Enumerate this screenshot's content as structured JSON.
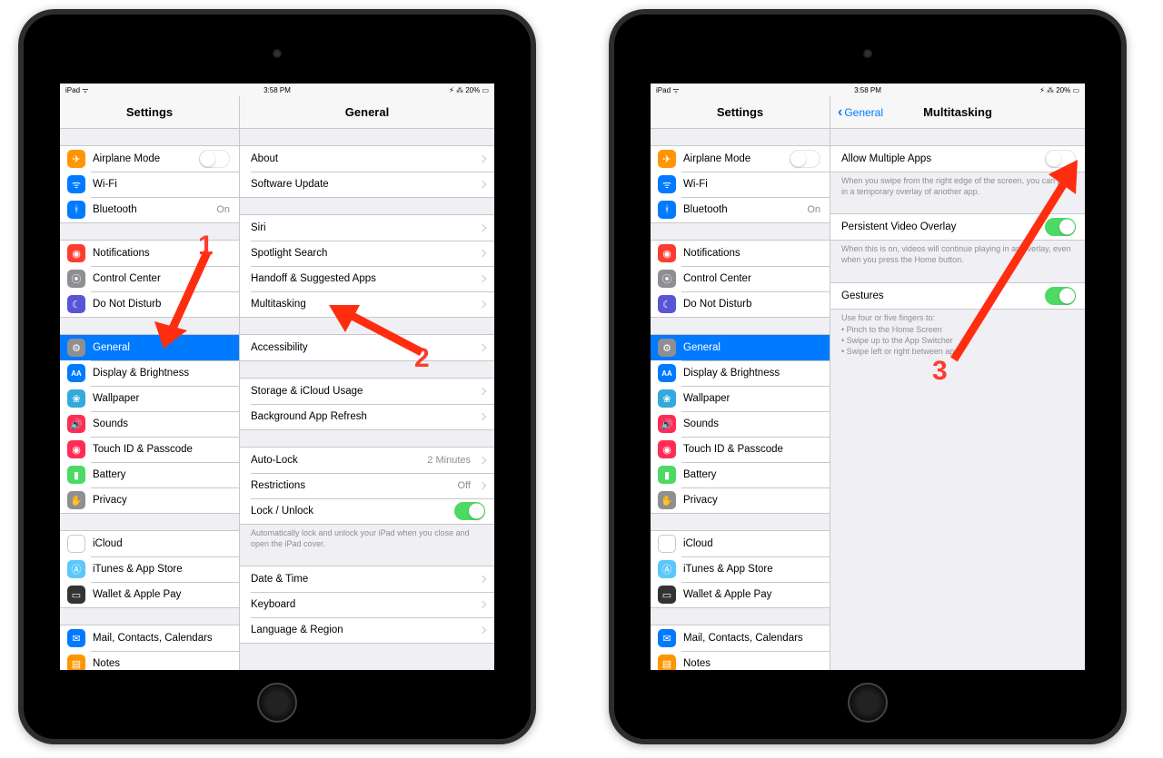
{
  "status": {
    "carrier": "iPad ᯤ",
    "time": "3:58 PM",
    "battery": "⚡︎ ⁂ 20% ▭"
  },
  "sidebar": {
    "title": "Settings",
    "groups": [
      [
        {
          "icon": "airplane-icon",
          "color": "i-orange",
          "glyph": "✈",
          "label": "Airplane Mode",
          "toggle": false
        },
        {
          "icon": "wifi-icon",
          "color": "i-blue",
          "glyph": "ᯤ",
          "label": "Wi-Fi"
        },
        {
          "icon": "bluetooth-icon",
          "color": "i-blue",
          "glyph": "ᚼ",
          "label": "Bluetooth",
          "value": "On"
        }
      ],
      [
        {
          "icon": "notifications-icon",
          "color": "i-red",
          "glyph": "◉",
          "label": "Notifications"
        },
        {
          "icon": "control-center-icon",
          "color": "i-gray",
          "glyph": "⦿",
          "label": "Control Center"
        },
        {
          "icon": "dnd-icon",
          "color": "i-purple",
          "glyph": "☾",
          "label": "Do Not Disturb"
        }
      ],
      [
        {
          "icon": "general-icon",
          "color": "i-gray",
          "glyph": "⚙",
          "label": "General",
          "selected": true
        },
        {
          "icon": "display-icon",
          "color": "i-blue",
          "glyph": "AA",
          "label": "Display & Brightness"
        },
        {
          "icon": "wallpaper-icon",
          "color": "i-teal",
          "glyph": "❀",
          "label": "Wallpaper"
        },
        {
          "icon": "sounds-icon",
          "color": "i-pink",
          "glyph": "🔊",
          "label": "Sounds"
        },
        {
          "icon": "touchid-icon",
          "color": "i-pink",
          "glyph": "◉",
          "label": "Touch ID & Passcode"
        },
        {
          "icon": "battery-icon",
          "color": "i-green",
          "glyph": "▮",
          "label": "Battery"
        },
        {
          "icon": "privacy-icon",
          "color": "i-gray",
          "glyph": "✋",
          "label": "Privacy"
        }
      ],
      [
        {
          "icon": "icloud-icon",
          "color": "i-white",
          "glyph": "☁",
          "label": "iCloud"
        },
        {
          "icon": "appstore-icon",
          "color": "i-skyblue",
          "glyph": "Ⓐ",
          "label": "iTunes & App Store"
        },
        {
          "icon": "wallet-icon",
          "color": "i-black",
          "glyph": "▭",
          "label": "Wallet & Apple Pay"
        }
      ],
      [
        {
          "icon": "mail-icon",
          "color": "i-blue",
          "glyph": "✉",
          "label": "Mail, Contacts, Calendars"
        },
        {
          "icon": "notes-icon",
          "color": "i-orange",
          "glyph": "▤",
          "label": "Notes"
        }
      ]
    ]
  },
  "general": {
    "title": "General",
    "groups": [
      [
        {
          "label": "About"
        },
        {
          "label": "Software Update"
        }
      ],
      [
        {
          "label": "Siri"
        },
        {
          "label": "Spotlight Search"
        },
        {
          "label": "Handoff & Suggested Apps"
        },
        {
          "label": "Multitasking"
        }
      ],
      [
        {
          "label": "Accessibility"
        }
      ],
      [
        {
          "label": "Storage & iCloud Usage"
        },
        {
          "label": "Background App Refresh"
        }
      ],
      [
        {
          "label": "Auto-Lock",
          "value": "2 Minutes"
        },
        {
          "label": "Restrictions",
          "value": "Off"
        },
        {
          "label": "Lock / Unlock",
          "toggle": true
        }
      ]
    ],
    "footnote_lock": "Automatically lock and unlock your iPad when you close and open the iPad cover.",
    "groups2": [
      [
        {
          "label": "Date & Time"
        },
        {
          "label": "Keyboard"
        },
        {
          "label": "Language & Region"
        }
      ]
    ]
  },
  "multitasking": {
    "title": "Multitasking",
    "back": "General",
    "items": [
      {
        "label": "Allow Multiple Apps",
        "toggle": false,
        "note": "When you swipe from the right edge of the screen, you can pull in a temporary overlay of another app."
      },
      {
        "label": "Persistent Video Overlay",
        "toggle": true,
        "note": "When this is on, videos will continue playing in an overlay, even when you press the Home button."
      },
      {
        "label": "Gestures",
        "toggle": true
      }
    ],
    "gestures_note": "Use four or five fingers to:",
    "gestures_list": [
      "Pinch to the Home Screen",
      "Swipe up to the App Switcher",
      "Swipe left or right between apps"
    ]
  },
  "callouts": {
    "one": "1",
    "two": "2",
    "three": "3"
  }
}
